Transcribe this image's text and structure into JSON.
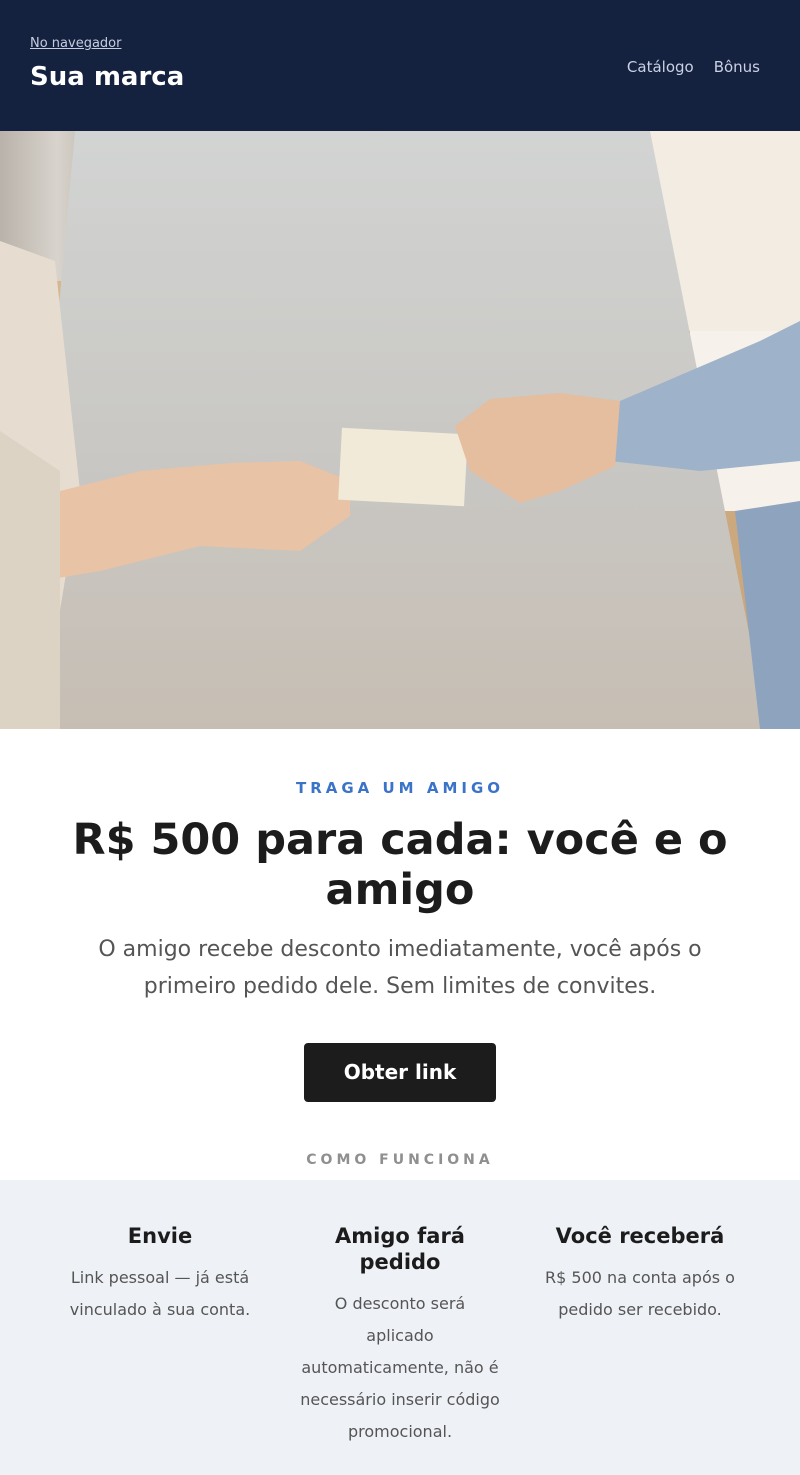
{
  "header": {
    "browser_link": "No navegador",
    "brand": "Sua marca",
    "nav": [
      {
        "label": "Catálogo"
      },
      {
        "label": "Bônus"
      }
    ]
  },
  "hero": {
    "image_icon": "hands-passing-card-photo"
  },
  "promo": {
    "eyebrow": "TRAGA UM AMIGO",
    "headline": "R$ 500 para cada: você e o amigo",
    "subtext": "O amigo recebe desconto imediatamente, você após o primeiro pedido dele. Sem limites de convites.",
    "cta": "Obter link"
  },
  "how": {
    "title": "COMO FUNCIONA",
    "steps": [
      {
        "title": "Envie",
        "text": "Link pessoal — já está vinculado à sua conta."
      },
      {
        "title": "Amigo fará pedido",
        "text": "O desconto será aplicado automaticamente, não é necessário inserir código promocional."
      },
      {
        "title": "Você receberá",
        "text": "R$ 500 na conta após o pedido ser recebido."
      }
    ]
  },
  "colors": {
    "header_bg": "#14213f",
    "accent": "#3b73c8",
    "cta_bg": "#1c1c1c",
    "steps_bg": "#eef1f6"
  }
}
